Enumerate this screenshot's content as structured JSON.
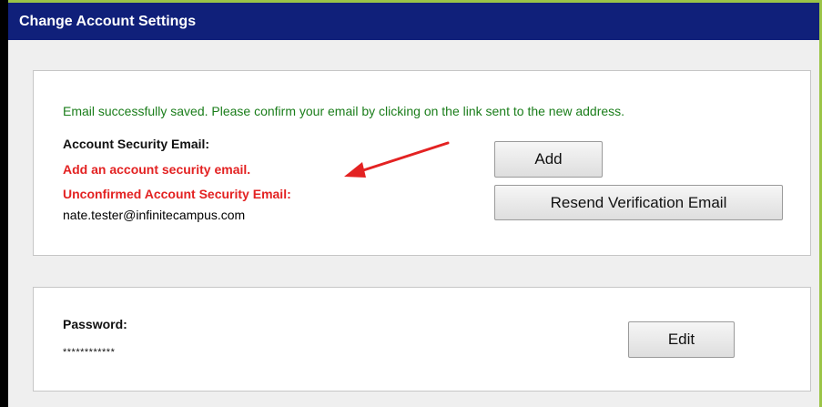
{
  "window": {
    "title": "Change Account Settings"
  },
  "email_section": {
    "success_message": "Email successfully saved. Please confirm your email by clicking on the link sent to the new address.",
    "security_email_label": "Account Security Email:",
    "add_prompt": "Add an account security email.",
    "unconfirmed_label": "Unconfirmed Account Security Email:",
    "unconfirmed_value": "nate.tester@infinitecampus.com",
    "add_button_label": "Add",
    "resend_button_label": "Resend Verification Email"
  },
  "password_section": {
    "label": "Password:",
    "masked_value": "************",
    "edit_button_label": "Edit"
  },
  "colors": {
    "title_bar": "#10207a",
    "success_text": "#1a7d1a",
    "error_text": "#e32222",
    "annotation_arrow": "#e32222",
    "accent_border": "#9bc447"
  },
  "annotations": {
    "arrow_icon": "red-arrow-icon"
  }
}
